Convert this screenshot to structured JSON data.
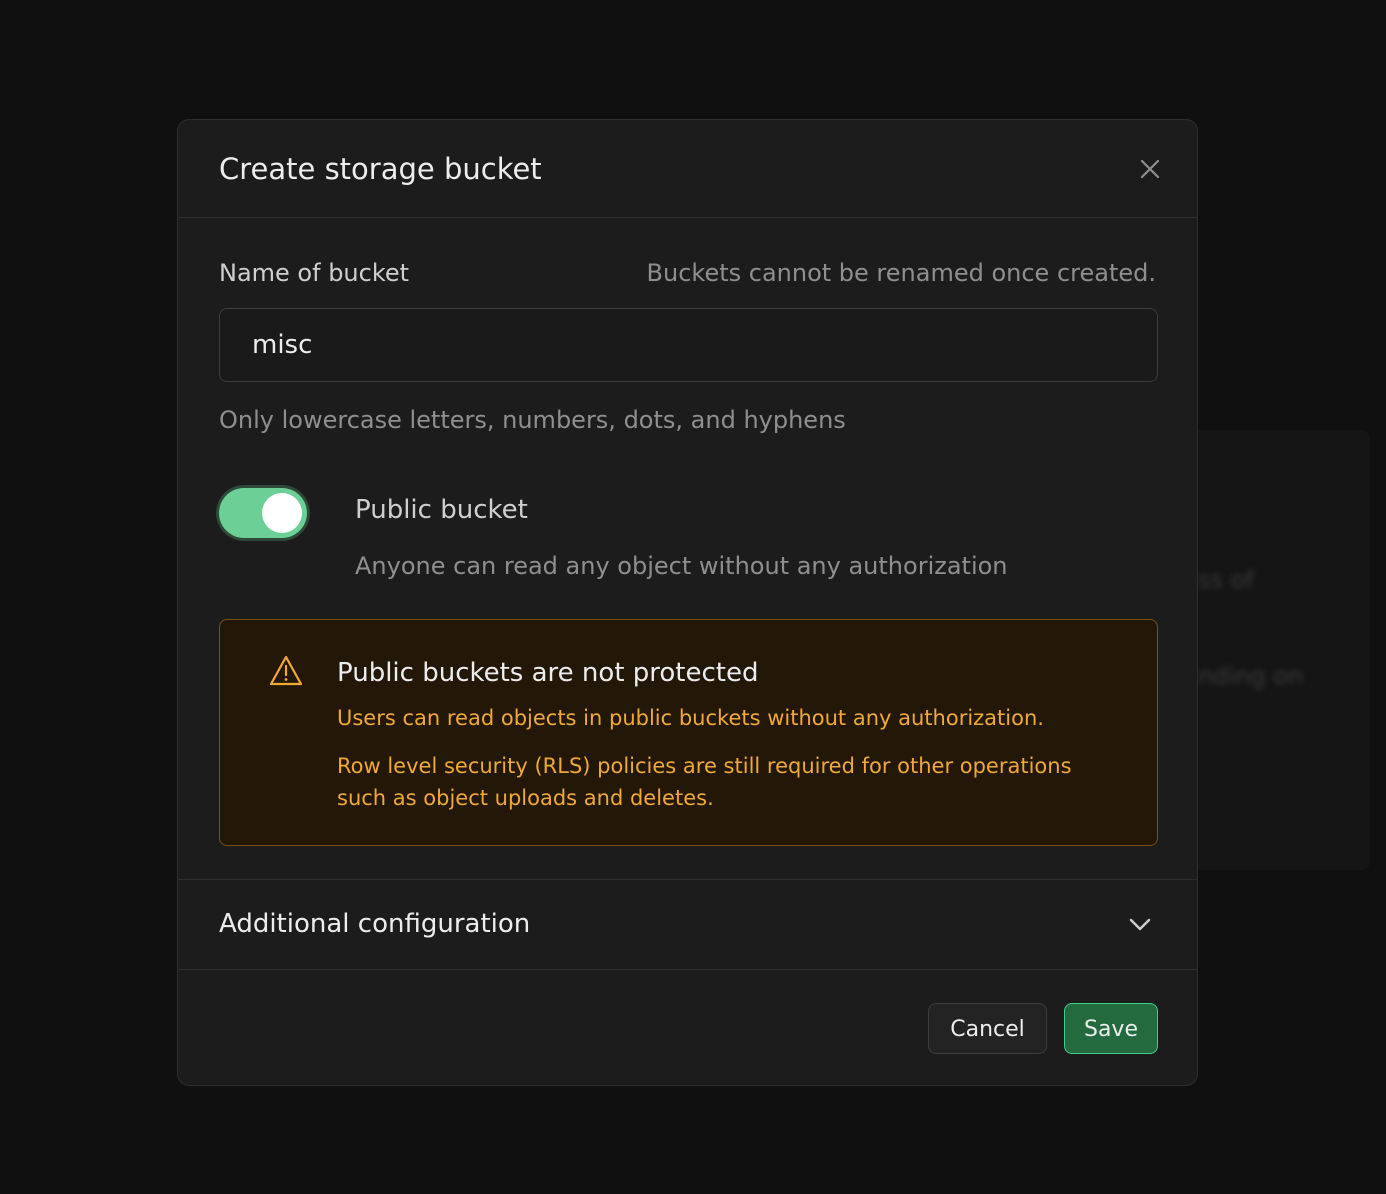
{
  "background": {
    "blur_texts": [
      "ss of",
      "nding on"
    ]
  },
  "modal": {
    "title": "Create storage bucket",
    "close_icon": "close-icon"
  },
  "name_field": {
    "label": "Name of bucket",
    "hint_right": "Buckets cannot be renamed once created.",
    "value": "misc",
    "help": "Only lowercase letters, numbers, dots, and hyphens"
  },
  "public_toggle": {
    "label": "Public bucket",
    "description": "Anyone can read any object without any authorization",
    "enabled": true,
    "on_color": "#6ccf95"
  },
  "warning": {
    "icon": "warning-triangle-icon",
    "title": "Public buckets are not protected",
    "line1": "Users can read objects in public buckets without any authorization.",
    "line2": "Row level security (RLS) policies are still required for other operations such as object uploads and deletes.",
    "accent_color": "#f0a935"
  },
  "additional_config": {
    "label": "Additional configuration",
    "icon": "chevron-down-icon"
  },
  "footer": {
    "cancel_label": "Cancel",
    "save_label": "Save",
    "brand_color": "#3ecf8e"
  }
}
